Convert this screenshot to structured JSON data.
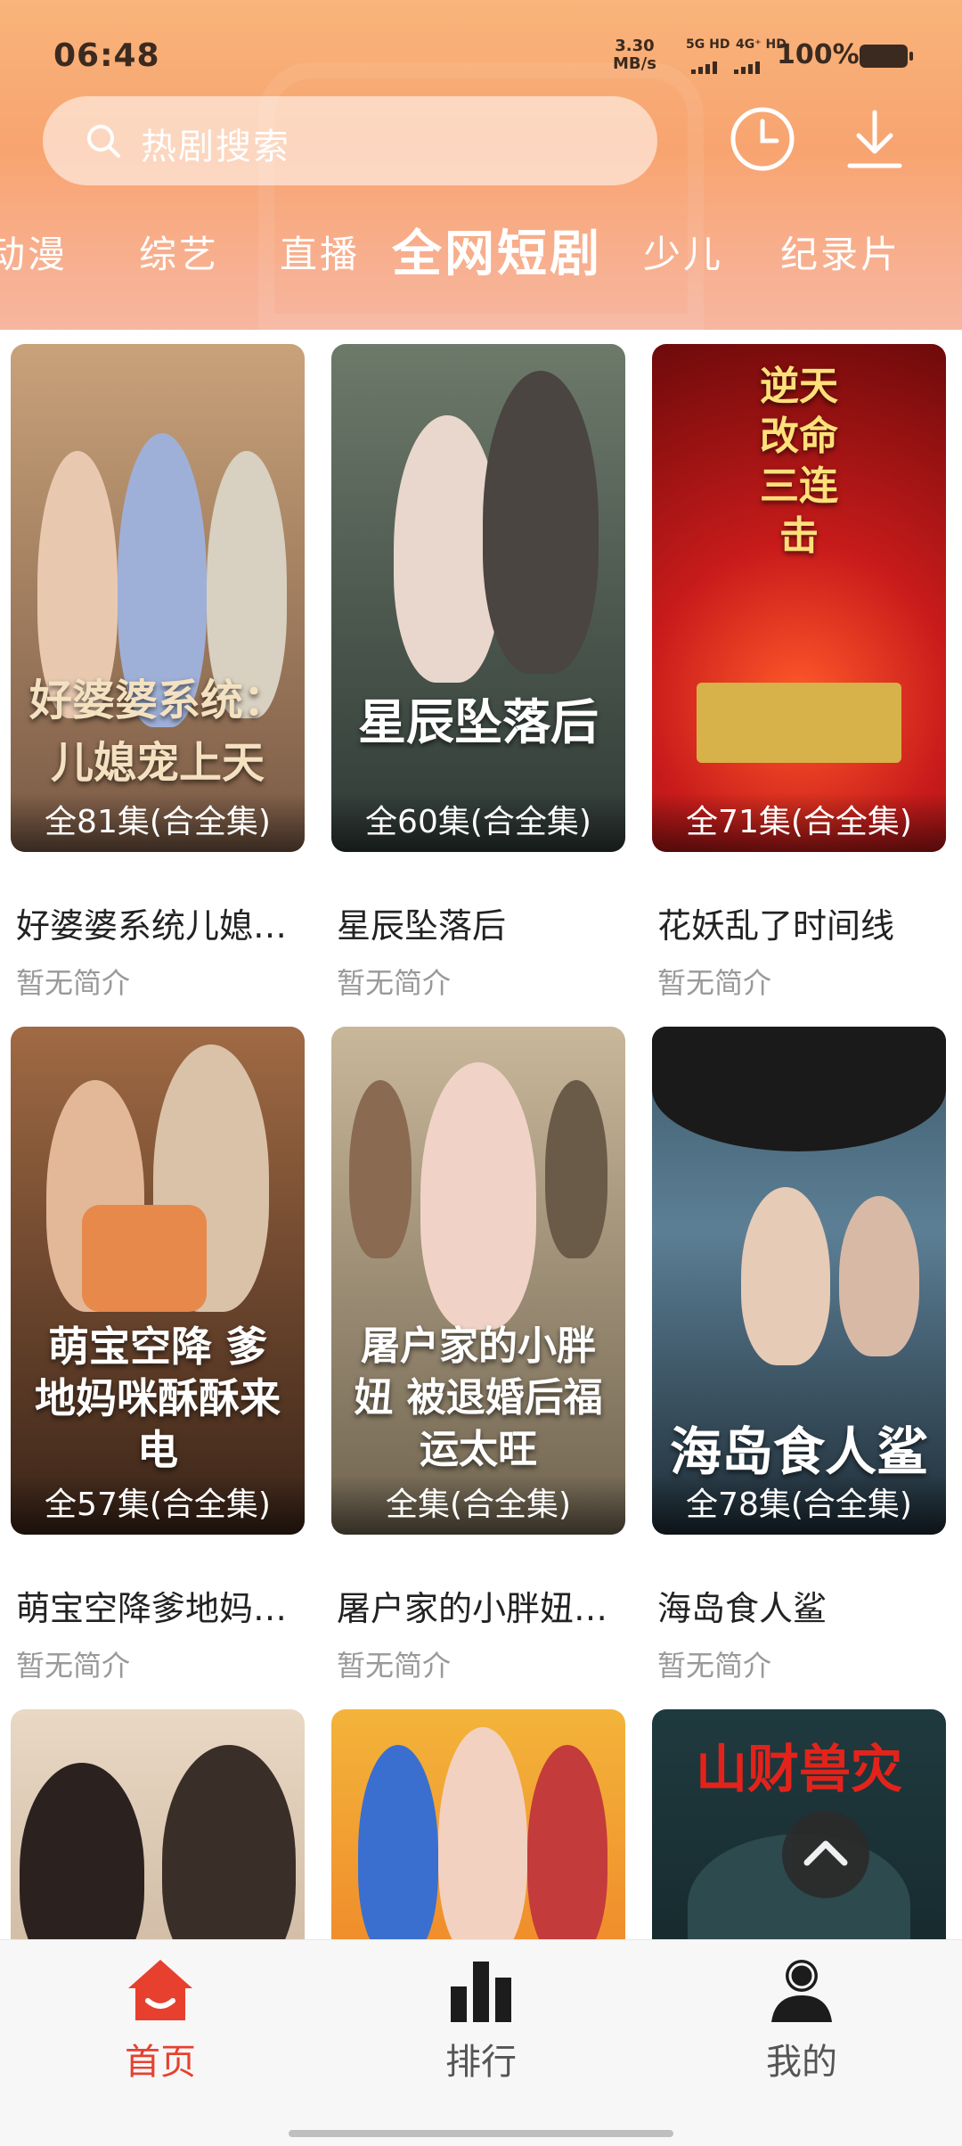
{
  "status": {
    "time": "06:48",
    "speed_value": "3.30",
    "speed_unit": "MB/s",
    "net1": "5G HD",
    "net2": "4G⁺ HD",
    "battery": "100%"
  },
  "search": {
    "placeholder": "热剧搜索"
  },
  "icons": {
    "search": "search-icon",
    "history": "clock-icon",
    "download": "download-icon",
    "scroll_top": "chevron-up-icon",
    "home": "home-icon",
    "rank": "bar-chart-icon",
    "profile": "user-icon"
  },
  "tabs": [
    {
      "label": "动漫"
    },
    {
      "label": "综艺"
    },
    {
      "label": "直播"
    },
    {
      "label": "全网短剧",
      "active": true
    },
    {
      "label": "少儿"
    },
    {
      "label": "纪录片"
    }
  ],
  "cards": [
    {
      "poster_text": "好婆婆系统：儿媳宠上天",
      "episodes": "全81集(合全集)",
      "name": "好婆婆系统儿媳宠上天",
      "desc": "暂无简介",
      "color_a": "#c9a27a",
      "color_b": "#7a5a45"
    },
    {
      "poster_text": "星辰坠落后",
      "episodes": "全60集(合全集)",
      "name": "星辰坠落后",
      "desc": "暂无简介",
      "color_a": "#6d7a6a",
      "color_b": "#2f3a36"
    },
    {
      "poster_text": "逆天改命三连击",
      "episodes": "全71集(合全集)",
      "name": "花妖乱了时间线",
      "desc": "暂无简介",
      "color_a": "#c81b1b",
      "color_b": "#6e0a0a"
    },
    {
      "poster_text": "萌宝空降 爹地妈咪酥酥来电",
      "episodes": "全57集(合全集)",
      "name": "萌宝空降爹地妈咪酥酥来电",
      "desc": "暂无简介",
      "color_a": "#a06a44",
      "color_b": "#3a2418"
    },
    {
      "poster_text": "屠户家的小胖妞 被退婚后福运太旺",
      "episodes": "全集(合全集)",
      "name": "屠户家的小胖妞被退婚后福运太旺",
      "desc": "暂无简介",
      "color_a": "#c9b79a",
      "color_b": "#6f6450"
    },
    {
      "poster_text": "海岛食人鲨",
      "episodes": "全78集(合全集)",
      "name": "海岛食人鲨",
      "desc": "暂无简介",
      "color_a": "#5c7f95",
      "color_b": "#1e2c36"
    },
    {
      "poster_text": "",
      "episodes": "",
      "name": "",
      "desc": "",
      "color_a": "#e9d8c4",
      "color_b": "#b89e86"
    },
    {
      "poster_text": "",
      "episodes": "",
      "name": "",
      "desc": "",
      "color_a": "#f3b43a",
      "color_b": "#3a6fcf"
    },
    {
      "poster_text": "山财兽灾",
      "episodes": "",
      "name": "",
      "desc": "",
      "color_a": "#1f3a3f",
      "color_b": "#0e1a1c"
    }
  ],
  "nav": [
    {
      "label": "首页",
      "active": true
    },
    {
      "label": "排行"
    },
    {
      "label": "我的"
    }
  ],
  "colors": {
    "accent": "#e8402e",
    "header_top": "#f9b47a",
    "header_bottom": "#f7b6a1"
  }
}
